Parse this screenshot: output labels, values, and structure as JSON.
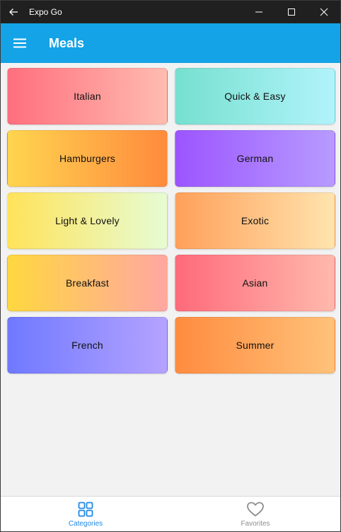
{
  "window": {
    "title": "Expo Go"
  },
  "header": {
    "title": "Meals"
  },
  "categories": [
    {
      "label": "Italian",
      "from": "#ff6f7d",
      "to": "#ffbcb0"
    },
    {
      "label": "Quick & Easy",
      "from": "#76e0cf",
      "to": "#b1f3fb"
    },
    {
      "label": "Hamburgers",
      "from": "#ffd54f",
      "to": "#ff8a3d"
    },
    {
      "label": "German",
      "from": "#9c55ff",
      "to": "#b79bff"
    },
    {
      "label": "Light & Lovely",
      "from": "#ffe35a",
      "to": "#e6fcd4"
    },
    {
      "label": "Exotic",
      "from": "#ffa05a",
      "to": "#ffe4ae"
    },
    {
      "label": "Breakfast",
      "from": "#ffd83f",
      "to": "#ffa7a2"
    },
    {
      "label": "Asian",
      "from": "#ff6a7a",
      "to": "#ffb9ad"
    },
    {
      "label": "French",
      "from": "#6f79ff",
      "to": "#b5a3ff"
    },
    {
      "label": "Summer",
      "from": "#ff8c3f",
      "to": "#ffc27a"
    }
  ],
  "tabs": [
    {
      "label": "Categories",
      "icon": "grid-icon",
      "active": true
    },
    {
      "label": "Favorites",
      "icon": "heart-icon",
      "active": false
    }
  ],
  "colors": {
    "header_bg": "#14a3e6",
    "active_tab": "#1e88e5",
    "inactive_tab": "#8e8e93"
  }
}
